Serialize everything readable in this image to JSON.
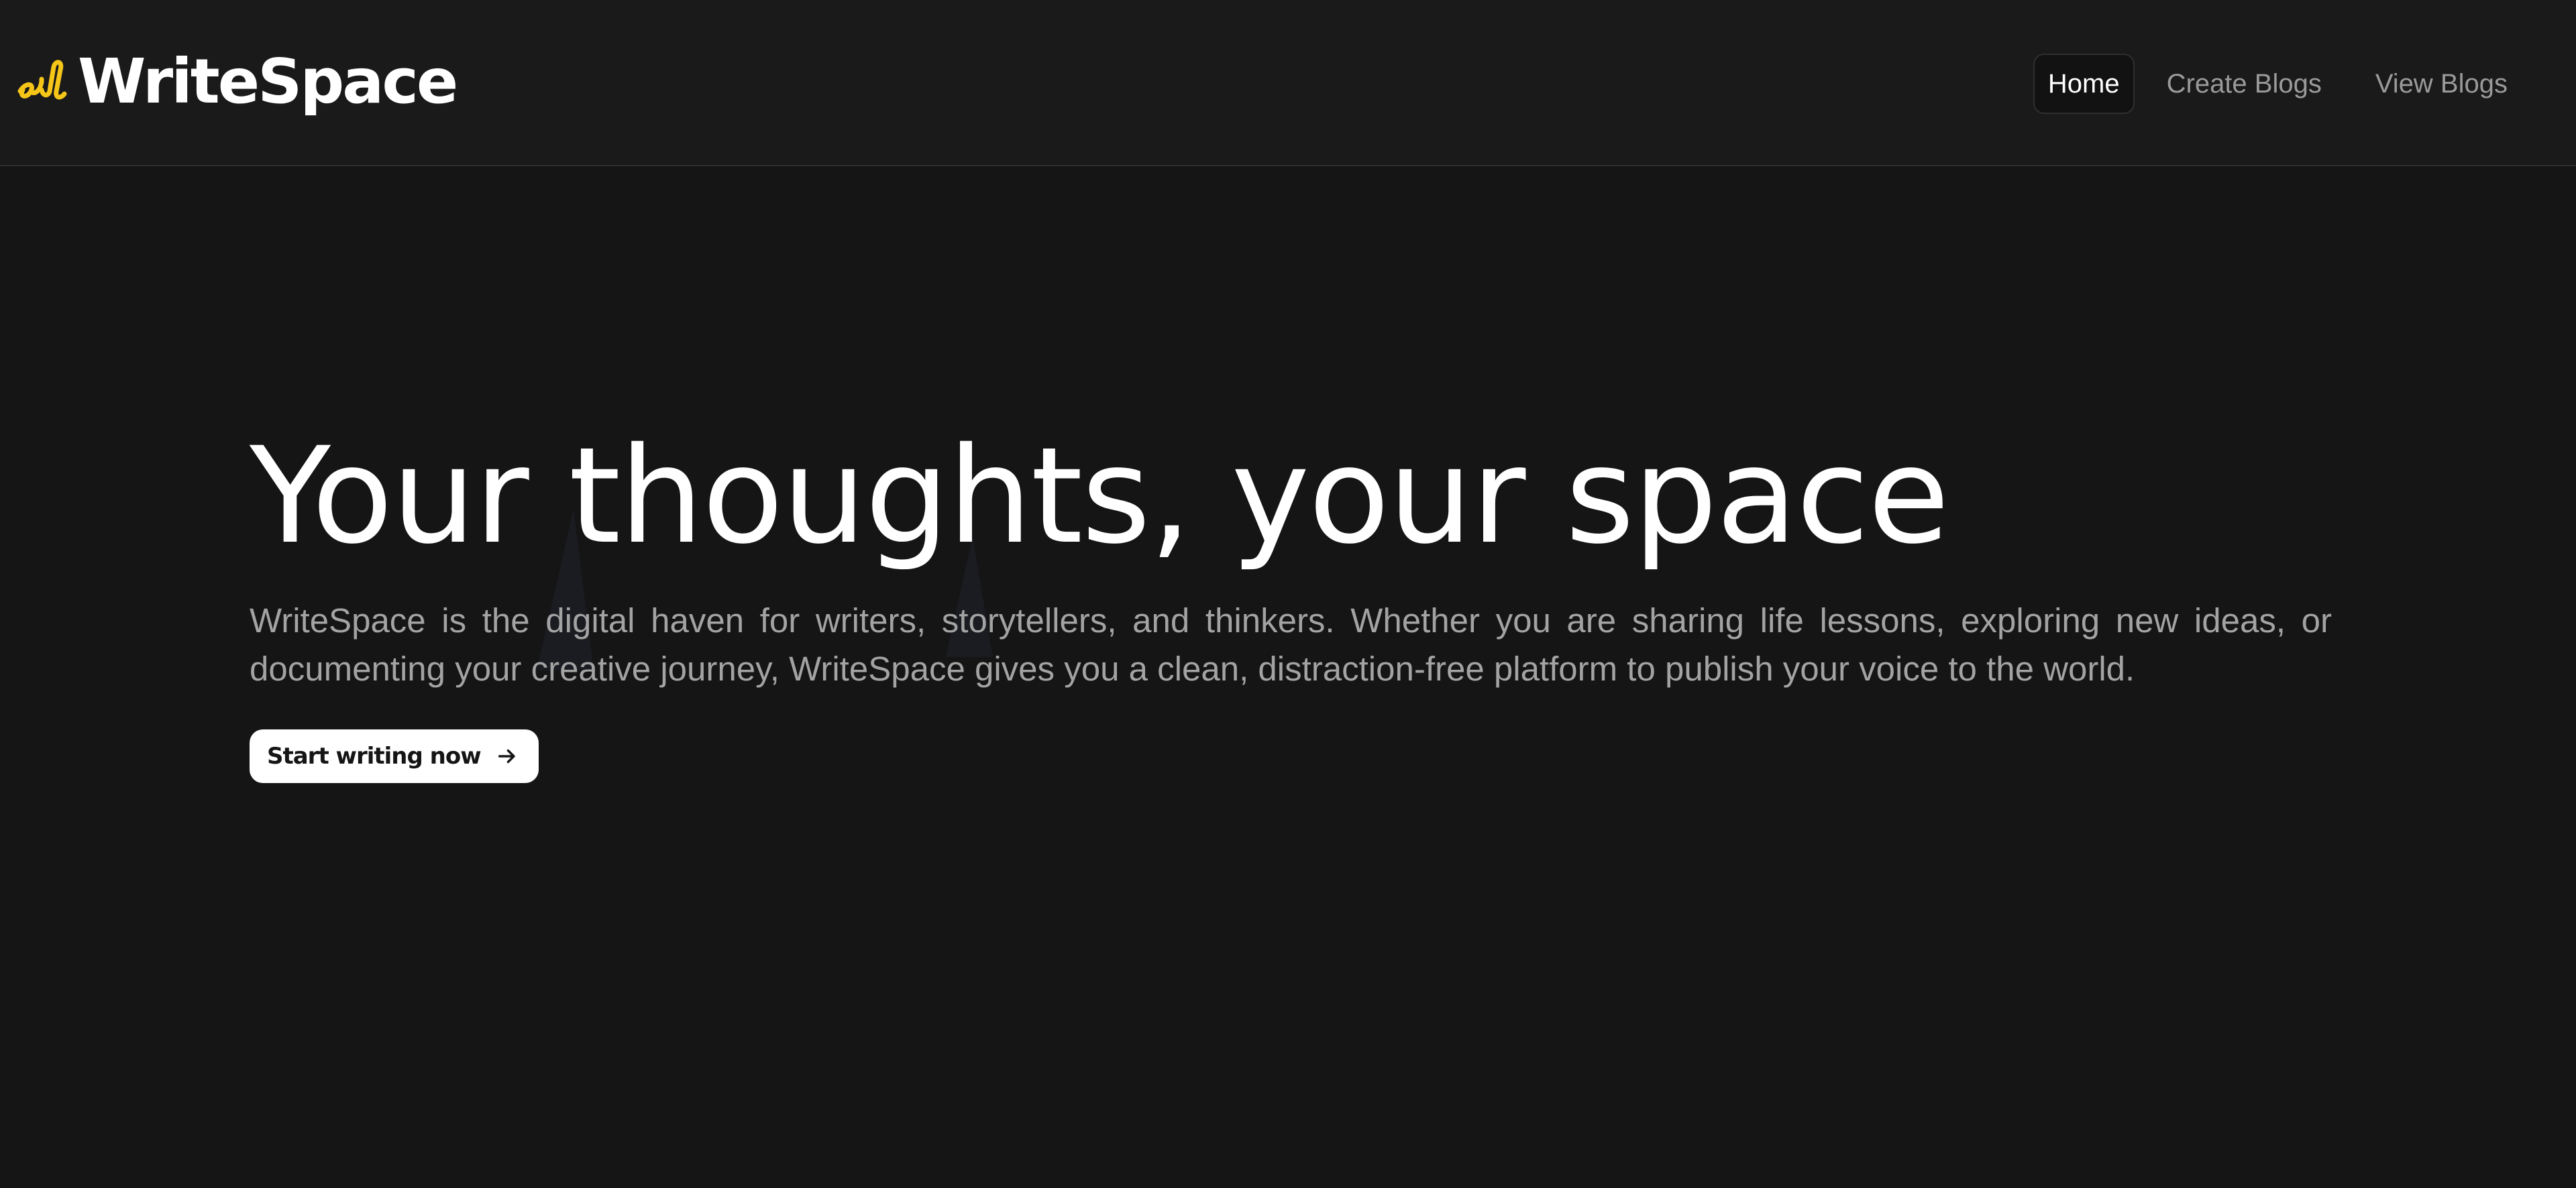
{
  "brand": {
    "name": "WriteSpace",
    "logo_icon": "pen-scribble-icon",
    "accent_color": "#f5c518"
  },
  "nav": {
    "items": [
      {
        "label": "Home",
        "active": true
      },
      {
        "label": "Create Blogs",
        "active": false
      },
      {
        "label": "View Blogs",
        "active": false
      }
    ]
  },
  "hero": {
    "title": "Your thoughts, your space",
    "description": "WriteSpace is the digital haven for writers, storytellers, and thinkers. Whether you are sharing life lessons, exploring new ideas, or documenting your creative journey, WriteSpace gives you a clean, distraction-free platform to publish your voice to the world.",
    "cta_label": "Start writing now",
    "cta_icon": "arrow-right-icon"
  },
  "colors": {
    "background": "#151515",
    "navbar_background": "#1a1a1a",
    "text_primary": "#ffffff",
    "text_muted": "#a3a3a3"
  }
}
